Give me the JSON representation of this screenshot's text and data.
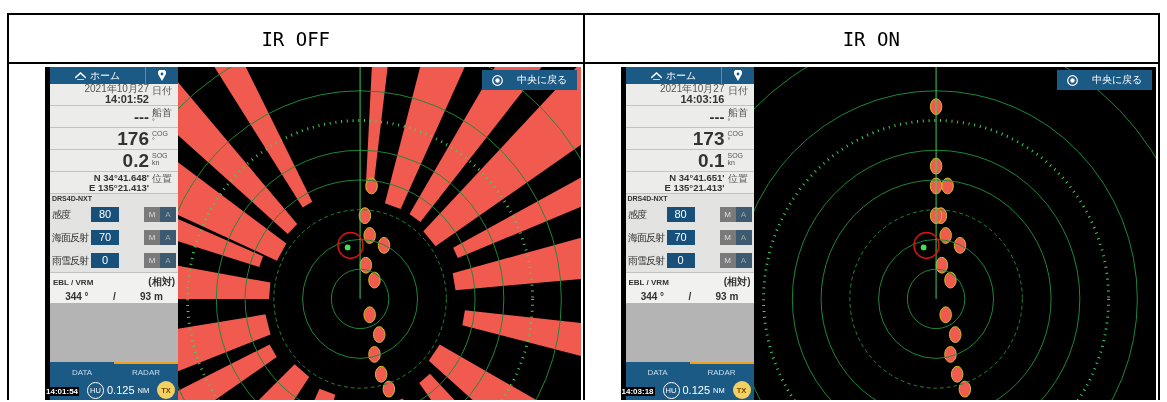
{
  "table": {
    "columns": [
      {
        "header": "IR OFF"
      },
      {
        "header": "IR ON"
      }
    ],
    "panels": [
      {
        "kind": "cluttered",
        "home_label": "ホーム",
        "date": "2021年10月27",
        "time": "14:01:52",
        "date_label": "日付",
        "heading": "---",
        "heading_label": "船首",
        "heading_unit": "°",
        "cog": "176",
        "cog_label": "COG",
        "cog_unit": "°",
        "sog": "0.2",
        "sog_label": "SOG",
        "sog_unit": "kn",
        "lat": "N 34°41.648'",
        "lon": "E 135°21.413'",
        "position_label": "位置",
        "model": "DRS4D-NXT",
        "controls": [
          {
            "label": "感度",
            "value": "80",
            "mode_m": "M",
            "mode_a": "A",
            "manual": true
          },
          {
            "label": "海面反射",
            "value": "70",
            "mode_m": "M",
            "mode_a": "A",
            "manual": true
          },
          {
            "label": "雨雪反射",
            "value": "0",
            "mode_m": "M",
            "mode_a": "A",
            "manual": true
          }
        ],
        "ebl_label": "EBL / VRM",
        "ebl_mode": "(相対)",
        "bearing": "344 °",
        "separator": "/",
        "range": "93 m",
        "tabs": [
          {
            "label": "DATA",
            "selected": false
          },
          {
            "label": "RADAR",
            "selected": true
          }
        ],
        "orientation": "HU",
        "scale": "0.125",
        "scale_unit": "NM",
        "tx": "TX",
        "center_button": "中央に戻る",
        "timestamp": "14:01:54"
      },
      {
        "kind": "clean",
        "home_label": "ホーム",
        "date": "2021年10月27",
        "time": "14:03:16",
        "date_label": "日付",
        "heading": "---",
        "heading_label": "船首",
        "heading_unit": "°",
        "cog": "173",
        "cog_label": "COG",
        "cog_unit": "°",
        "sog": "0.1",
        "sog_label": "SOG",
        "sog_unit": "kn",
        "lat": "N 34°41.651'",
        "lon": "E 135°21.413'",
        "position_label": "位置",
        "model": "DRS4D-NXT",
        "controls": [
          {
            "label": "感度",
            "value": "80",
            "mode_m": "M",
            "mode_a": "A",
            "manual": true
          },
          {
            "label": "海面反射",
            "value": "70",
            "mode_m": "M",
            "mode_a": "A",
            "manual": true
          },
          {
            "label": "雨雪反射",
            "value": "0",
            "mode_m": "M",
            "mode_a": "A",
            "manual": true
          }
        ],
        "ebl_label": "EBL / VRM",
        "ebl_mode": "(相対)",
        "bearing": "344 °",
        "separator": "/",
        "range": "93 m",
        "tabs": [
          {
            "label": "DATA",
            "selected": false
          },
          {
            "label": "RADAR",
            "selected": true
          }
        ],
        "orientation": "HU",
        "scale": "0.125",
        "scale_unit": "NM",
        "tx": "TX",
        "center_button": "中央に戻る",
        "timestamp": "14:03:18"
      }
    ]
  }
}
